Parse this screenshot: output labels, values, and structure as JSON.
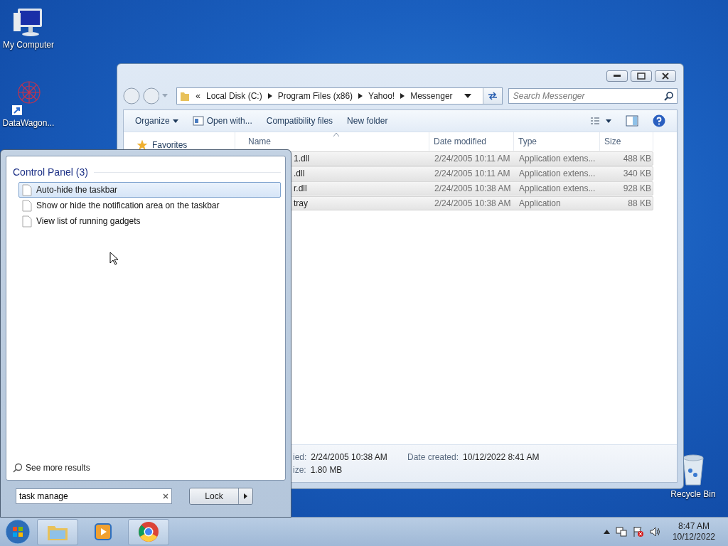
{
  "desktop_icons": [
    {
      "label": "My Computer",
      "kind": "computer"
    },
    {
      "label": "DataWagon...",
      "kind": "shortcut"
    },
    {
      "label": "Recycle Bin",
      "kind": "recycle"
    }
  ],
  "explorer": {
    "address_prefix": "«",
    "address": [
      "Local Disk (C:)",
      "Program Files (x86)",
      "Yahoo!",
      "Messenger"
    ],
    "search": {
      "placeholder": "Search Messenger"
    },
    "toolbar": [
      {
        "label": "Organize",
        "kind": "menu"
      },
      {
        "label": "Open with...",
        "kind": "icon"
      },
      {
        "label": "Compatibility files",
        "kind": "plain"
      },
      {
        "label": "New folder",
        "kind": "plain"
      }
    ],
    "nav": [
      {
        "label": "Favorites"
      }
    ],
    "columns": [
      "Name",
      "Date modified",
      "Type",
      "Size"
    ],
    "rows": [
      {
        "name": "1.dll",
        "date": "2/24/2005 10:11 AM",
        "type": "Application extens...",
        "size": "488 KB",
        "selected": true
      },
      {
        "name": ".dll",
        "date": "2/24/2005 10:11 AM",
        "type": "Application extens...",
        "size": "340 KB",
        "selected": true
      },
      {
        "name": "r.dll",
        "date": "2/24/2005 10:38 AM",
        "type": "Application extens...",
        "size": "928 KB",
        "selected": true
      },
      {
        "name": "tray",
        "date": "2/24/2005 10:38 AM",
        "type": "Application",
        "size": "88 KB",
        "selected": true
      }
    ],
    "details": [
      [
        {
          "label": "ied:",
          "value": "2/24/2005 10:38 AM"
        },
        {
          "label": "Date created:",
          "value": "10/12/2022 8:41 AM"
        }
      ],
      [
        {
          "label": "ize:",
          "value": "1.80 MB"
        }
      ]
    ]
  },
  "start_menu": {
    "group": "Control Panel (3)",
    "results": [
      {
        "label": "Auto-hide the taskbar",
        "selected": true
      },
      {
        "label": "Show or hide the notification area on the taskbar",
        "selected": false
      },
      {
        "label": "View list of running gadgets",
        "selected": false
      }
    ],
    "more": "See more results",
    "search": {
      "value": "task manage"
    },
    "power": "Lock"
  },
  "taskbar": {
    "buttons": [
      {
        "kind": "explorer",
        "active": true
      },
      {
        "kind": "media",
        "active": false
      },
      {
        "kind": "chrome",
        "active": true
      }
    ],
    "clock": {
      "time": "8:47 AM",
      "date": "10/12/2022"
    }
  }
}
